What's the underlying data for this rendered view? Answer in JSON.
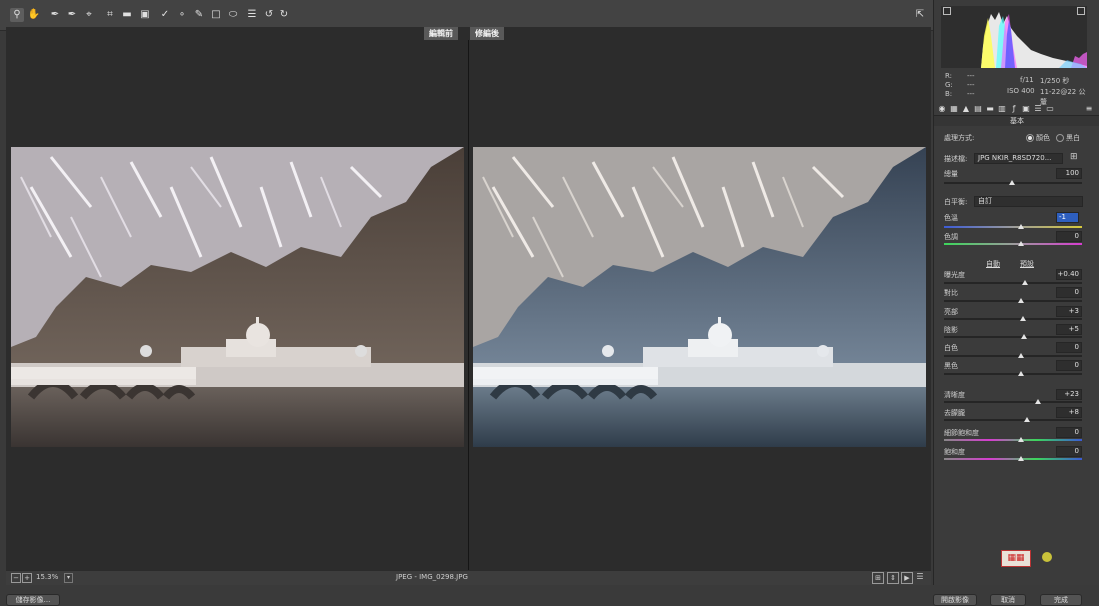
{
  "toolbar": {
    "tools": [
      "zoom-icon",
      "hand-icon",
      "white-balance-icon",
      "color-sampler-icon",
      "targeted-adjustment-icon",
      "crop-icon",
      "straighten-icon",
      "transform-icon",
      "spot-removal-icon",
      "red-eye-icon",
      "adjustment-brush-icon",
      "graduated-filter-icon",
      "radial-filter-icon",
      "preferences-icon",
      "rotate-left-icon",
      "rotate-right-icon"
    ],
    "right_icon": "fullscreen-icon"
  },
  "preview": {
    "before_label": "編輯前",
    "after_label": "修編後"
  },
  "bottombar": {
    "zoom": "15.3%",
    "filename": "JPEG - IMG_0298.JPG"
  },
  "histogram": {
    "r": "R:",
    "r_val": "---",
    "g": "G:",
    "g_val": "---",
    "b": "B:",
    "b_val": "---",
    "aperture": "f/11",
    "shutter": "1/250 秒",
    "iso": "ISO 400",
    "lens": "11-22@22 公釐"
  },
  "panel": {
    "section_title": "基本",
    "treatment_label": "處理方式:",
    "treatment_color": "顏色",
    "treatment_bw": "黑白",
    "profile_label": "描述檔:",
    "profile_value": "JPG NKIR_R8SD720...",
    "amount_label": "總量",
    "amount_value": "100",
    "wb_label": "白平衡:",
    "wb_value": "自訂",
    "temp_label": "色溫",
    "temp_value": "-1",
    "tint_label": "色調",
    "tint_value": "0",
    "auto_link": "自動",
    "default_link": "預設",
    "exposure_label": "曝光度",
    "exposure_value": "+0.40",
    "contrast_label": "對比",
    "contrast_value": "0",
    "highlights_label": "亮部",
    "highlights_value": "+3",
    "shadows_label": "陰影",
    "shadows_value": "+5",
    "whites_label": "白色",
    "whites_value": "0",
    "blacks_label": "黑色",
    "blacks_value": "0",
    "clarity_label": "清晰度",
    "clarity_value": "+23",
    "dehaze_label": "去朦朧",
    "dehaze_value": "+8",
    "vibrance_label": "細節飽和度",
    "vibrance_value": "0",
    "saturation_label": "飽和度",
    "saturation_value": "0"
  },
  "footer": {
    "save_label": "儲存影像...",
    "open_label": "開啟影像",
    "cancel_label": "取消",
    "done_label": "完成"
  }
}
